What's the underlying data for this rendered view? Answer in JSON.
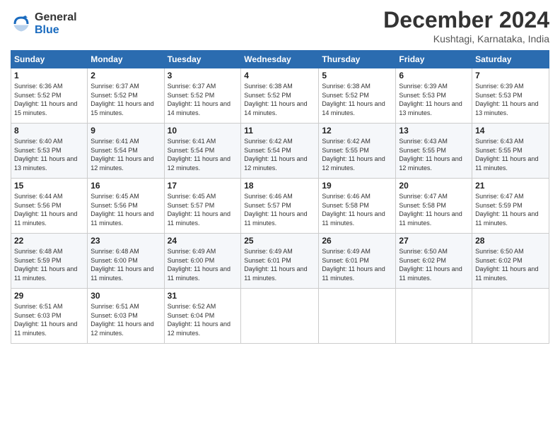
{
  "logo": {
    "general": "General",
    "blue": "Blue"
  },
  "header": {
    "month": "December 2024",
    "location": "Kushtagi, Karnataka, India"
  },
  "days_of_week": [
    "Sunday",
    "Monday",
    "Tuesday",
    "Wednesday",
    "Thursday",
    "Friday",
    "Saturday"
  ],
  "weeks": [
    [
      {
        "day": "1",
        "sunrise": "6:36 AM",
        "sunset": "5:52 PM",
        "daylight": "11 hours and 15 minutes."
      },
      {
        "day": "2",
        "sunrise": "6:37 AM",
        "sunset": "5:52 PM",
        "daylight": "11 hours and 15 minutes."
      },
      {
        "day": "3",
        "sunrise": "6:37 AM",
        "sunset": "5:52 PM",
        "daylight": "11 hours and 14 minutes."
      },
      {
        "day": "4",
        "sunrise": "6:38 AM",
        "sunset": "5:52 PM",
        "daylight": "11 hours and 14 minutes."
      },
      {
        "day": "5",
        "sunrise": "6:38 AM",
        "sunset": "5:52 PM",
        "daylight": "11 hours and 14 minutes."
      },
      {
        "day": "6",
        "sunrise": "6:39 AM",
        "sunset": "5:53 PM",
        "daylight": "11 hours and 13 minutes."
      },
      {
        "day": "7",
        "sunrise": "6:39 AM",
        "sunset": "5:53 PM",
        "daylight": "11 hours and 13 minutes."
      }
    ],
    [
      {
        "day": "8",
        "sunrise": "6:40 AM",
        "sunset": "5:53 PM",
        "daylight": "11 hours and 13 minutes."
      },
      {
        "day": "9",
        "sunrise": "6:41 AM",
        "sunset": "5:54 PM",
        "daylight": "11 hours and 12 minutes."
      },
      {
        "day": "10",
        "sunrise": "6:41 AM",
        "sunset": "5:54 PM",
        "daylight": "11 hours and 12 minutes."
      },
      {
        "day": "11",
        "sunrise": "6:42 AM",
        "sunset": "5:54 PM",
        "daylight": "11 hours and 12 minutes."
      },
      {
        "day": "12",
        "sunrise": "6:42 AM",
        "sunset": "5:55 PM",
        "daylight": "11 hours and 12 minutes."
      },
      {
        "day": "13",
        "sunrise": "6:43 AM",
        "sunset": "5:55 PM",
        "daylight": "11 hours and 12 minutes."
      },
      {
        "day": "14",
        "sunrise": "6:43 AM",
        "sunset": "5:55 PM",
        "daylight": "11 hours and 11 minutes."
      }
    ],
    [
      {
        "day": "15",
        "sunrise": "6:44 AM",
        "sunset": "5:56 PM",
        "daylight": "11 hours and 11 minutes."
      },
      {
        "day": "16",
        "sunrise": "6:45 AM",
        "sunset": "5:56 PM",
        "daylight": "11 hours and 11 minutes."
      },
      {
        "day": "17",
        "sunrise": "6:45 AM",
        "sunset": "5:57 PM",
        "daylight": "11 hours and 11 minutes."
      },
      {
        "day": "18",
        "sunrise": "6:46 AM",
        "sunset": "5:57 PM",
        "daylight": "11 hours and 11 minutes."
      },
      {
        "day": "19",
        "sunrise": "6:46 AM",
        "sunset": "5:58 PM",
        "daylight": "11 hours and 11 minutes."
      },
      {
        "day": "20",
        "sunrise": "6:47 AM",
        "sunset": "5:58 PM",
        "daylight": "11 hours and 11 minutes."
      },
      {
        "day": "21",
        "sunrise": "6:47 AM",
        "sunset": "5:59 PM",
        "daylight": "11 hours and 11 minutes."
      }
    ],
    [
      {
        "day": "22",
        "sunrise": "6:48 AM",
        "sunset": "5:59 PM",
        "daylight": "11 hours and 11 minutes."
      },
      {
        "day": "23",
        "sunrise": "6:48 AM",
        "sunset": "6:00 PM",
        "daylight": "11 hours and 11 minutes."
      },
      {
        "day": "24",
        "sunrise": "6:49 AM",
        "sunset": "6:00 PM",
        "daylight": "11 hours and 11 minutes."
      },
      {
        "day": "25",
        "sunrise": "6:49 AM",
        "sunset": "6:01 PM",
        "daylight": "11 hours and 11 minutes."
      },
      {
        "day": "26",
        "sunrise": "6:49 AM",
        "sunset": "6:01 PM",
        "daylight": "11 hours and 11 minutes."
      },
      {
        "day": "27",
        "sunrise": "6:50 AM",
        "sunset": "6:02 PM",
        "daylight": "11 hours and 11 minutes."
      },
      {
        "day": "28",
        "sunrise": "6:50 AM",
        "sunset": "6:02 PM",
        "daylight": "11 hours and 11 minutes."
      }
    ],
    [
      {
        "day": "29",
        "sunrise": "6:51 AM",
        "sunset": "6:03 PM",
        "daylight": "11 hours and 11 minutes."
      },
      {
        "day": "30",
        "sunrise": "6:51 AM",
        "sunset": "6:03 PM",
        "daylight": "11 hours and 12 minutes."
      },
      {
        "day": "31",
        "sunrise": "6:52 AM",
        "sunset": "6:04 PM",
        "daylight": "11 hours and 12 minutes."
      },
      null,
      null,
      null,
      null
    ]
  ]
}
